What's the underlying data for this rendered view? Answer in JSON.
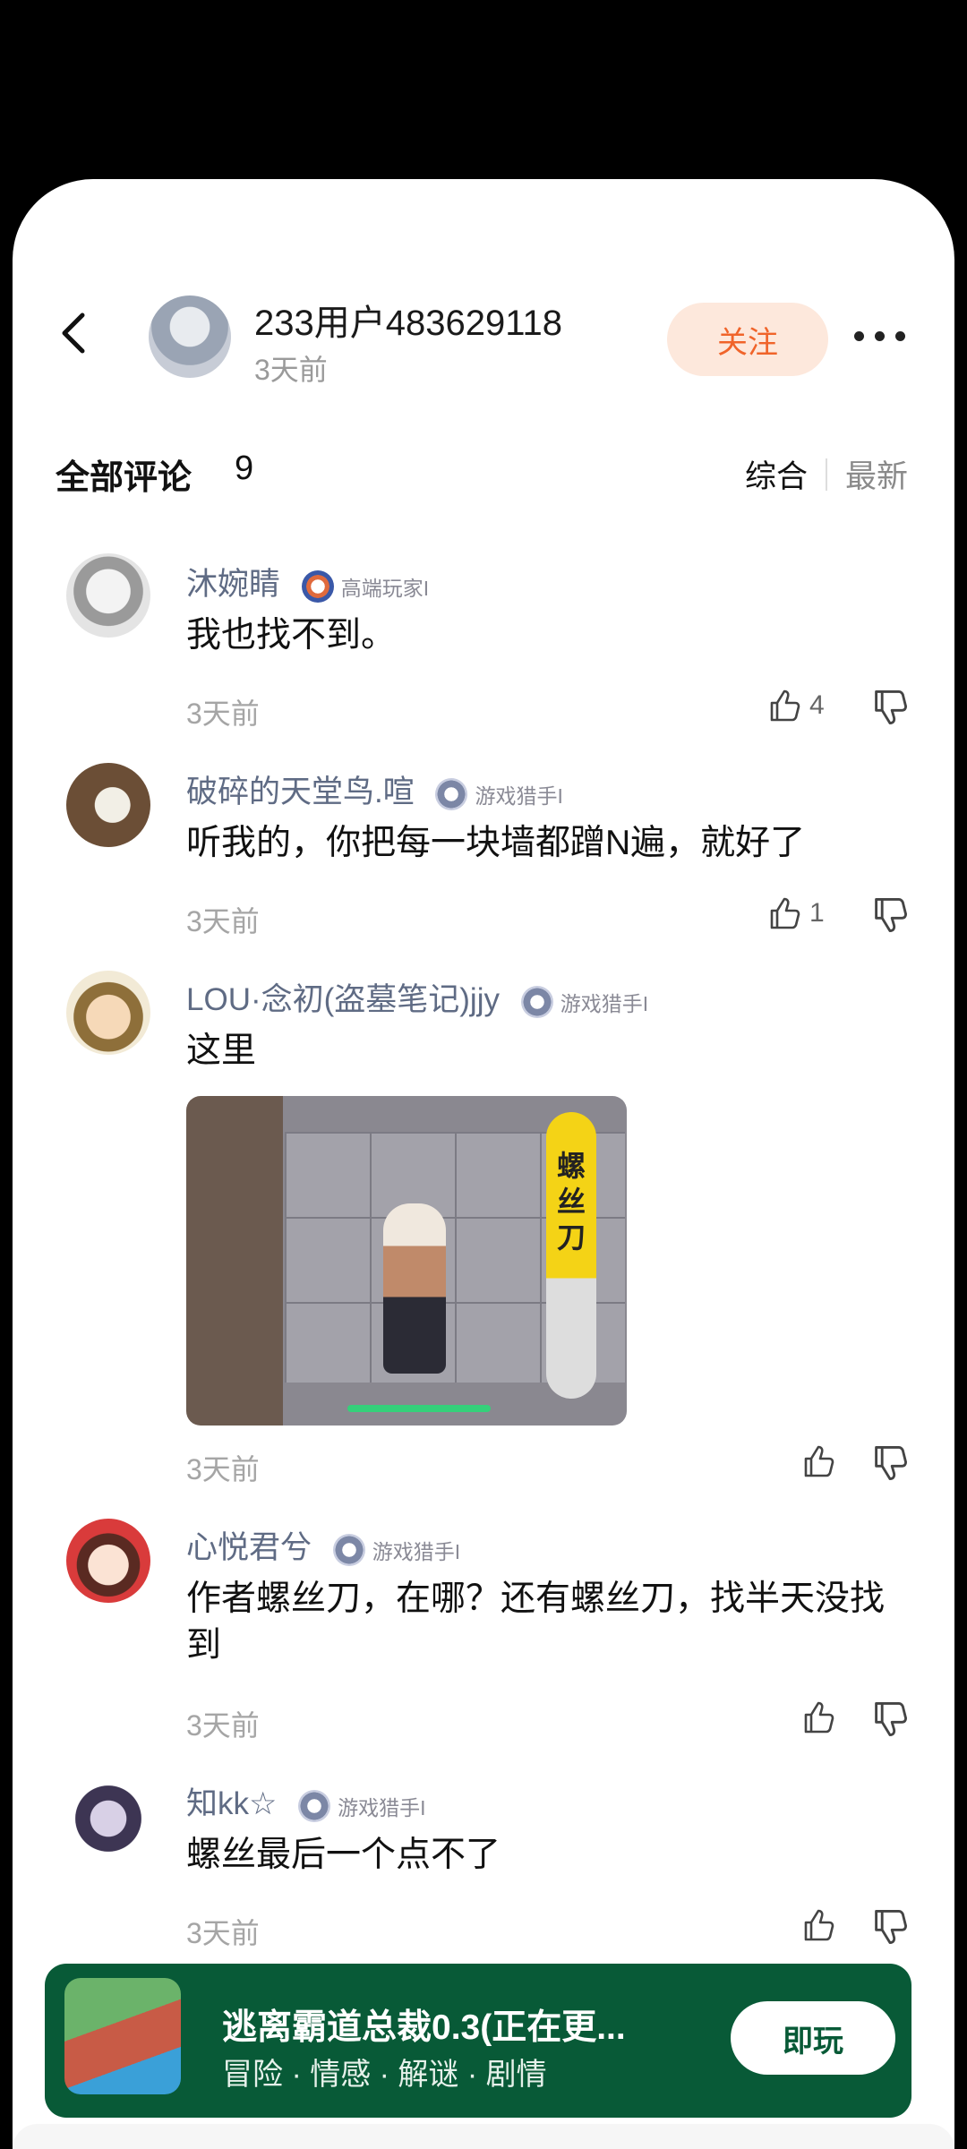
{
  "header": {
    "user_name": "233用户483629118",
    "user_time": "3天前",
    "follow_label": "关注"
  },
  "comments_header": {
    "title": "全部评论",
    "count": "9",
    "sort_options": [
      "综合",
      "最新"
    ]
  },
  "comments": [
    {
      "name": "沐婉睛",
      "badge": "高端玩家I",
      "text": "我也找不到。",
      "time": "3天前",
      "likes": "4"
    },
    {
      "name": "破碎的天堂鸟.喧",
      "badge": "游戏猎手I",
      "text": "听我的，你把每一块墙都蹭N遍，就好了",
      "time": "3天前",
      "likes": "1"
    },
    {
      "name": "LOU·念初(盗墓笔记)jjy",
      "badge": "游戏猎手I",
      "text": "这里",
      "time": "3天前",
      "likes": "",
      "image_sign": [
        "螺",
        "丝",
        "刀"
      ]
    },
    {
      "name": "心悦君兮",
      "badge": "游戏猎手I",
      "text": "作者螺丝刀，在哪？还有螺丝刀，找半天没找到",
      "time": "3天前",
      "likes": ""
    },
    {
      "name": "知kk☆",
      "badge": "游戏猎手I",
      "text": "螺丝最后一个点不了",
      "time": "3天前",
      "likes": ""
    }
  ],
  "banner": {
    "title": "逃离霸道总裁0.3(正在更...",
    "tags": "冒险 · 情感 · 解谜 · 剧情",
    "play_label": "即玩"
  },
  "colors": {
    "accent": "#f0642a",
    "banner_bg": "#085a37",
    "name_color": "#5f6b84"
  }
}
